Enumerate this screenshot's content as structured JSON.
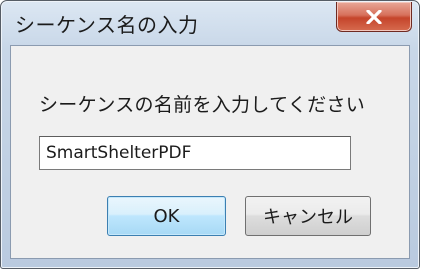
{
  "window": {
    "title": "シーケンス名の入力"
  },
  "dialog": {
    "prompt": "シーケンスの名前を入力してください",
    "input_value": "SmartShelterPDF"
  },
  "buttons": {
    "ok_label": "OK",
    "cancel_label": "キャンセル"
  },
  "icons": {
    "close": "close-icon"
  },
  "colors": {
    "close_button": "#c5452b",
    "default_button_border": "#3c7fb1"
  }
}
